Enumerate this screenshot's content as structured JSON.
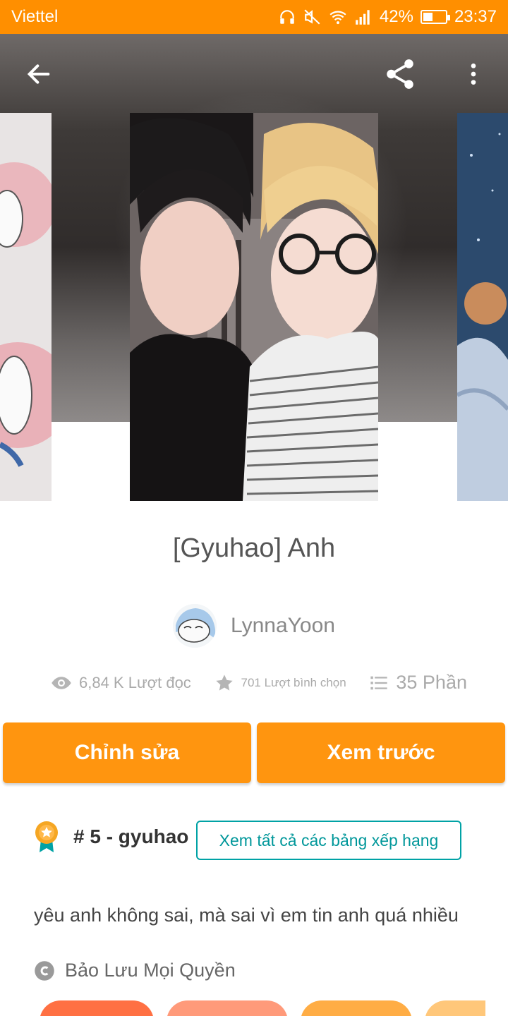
{
  "status_bar": {
    "carrier": "Viettel",
    "battery": "42%",
    "battery_level": 0.42,
    "time": "23:37",
    "icons": [
      "headphones-icon",
      "mute-icon",
      "wifi-icon",
      "signal-icon",
      "battery-icon"
    ]
  },
  "toolbar": {
    "back_icon": "arrow-left-icon",
    "share_icon": "share-icon",
    "more_icon": "more-vertical-icon"
  },
  "story": {
    "title": "[Gyuhao] Anh",
    "author": "LynnaYoon",
    "reads": "6,84 K Lượt đọc",
    "votes": "701 Lượt bình chọn",
    "parts": "35 Phần",
    "description": "yêu anh không sai, mà sai vì em tin anh quá nhiều",
    "copyright": "Bảo Lưu Mọi Quyền"
  },
  "actions": {
    "edit_label": "Chỉnh sửa",
    "preview_label": "Xem trước"
  },
  "ranking": {
    "label": "# 5 - gyuhao",
    "button_label": "Xem tất cả các bảng xếp hạng"
  },
  "tags": [
    {
      "label": "",
      "color": "#ff7043"
    },
    {
      "label": "",
      "color": "#ff9a7a"
    },
    {
      "label": "",
      "color": "#ffad45"
    },
    {
      "label": "",
      "color": "#ffc77a"
    }
  ],
  "colors": {
    "accent": "#ff950f",
    "status_bar": "#ff8f00",
    "teal": "#00a2a5"
  }
}
